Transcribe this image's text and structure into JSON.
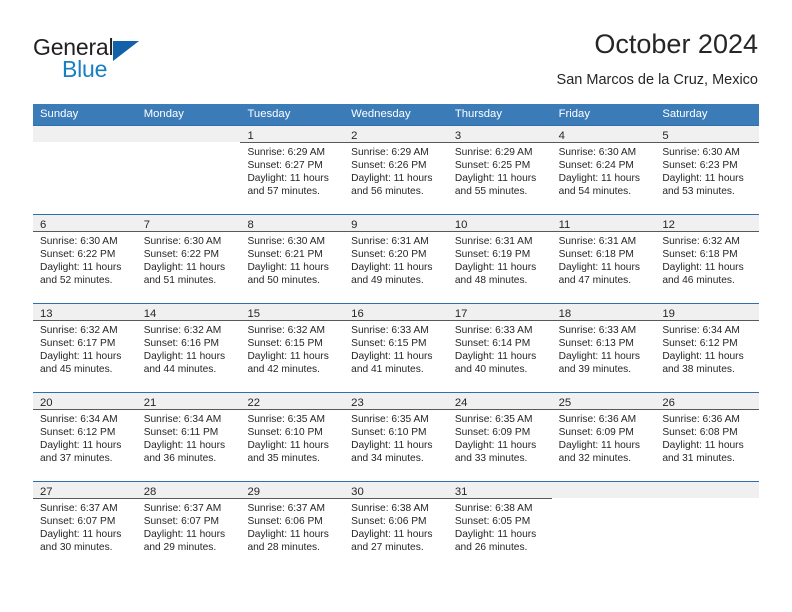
{
  "brand": {
    "name_part1": "General",
    "name_part2": "Blue"
  },
  "header": {
    "title": "October 2024",
    "subtitle": "San Marcos de la Cruz, Mexico"
  },
  "weekdays": [
    "Sunday",
    "Monday",
    "Tuesday",
    "Wednesday",
    "Thursday",
    "Friday",
    "Saturday"
  ],
  "colors": {
    "header_blue": "#3b7cb8",
    "row_rule_blue": "#2f6fae",
    "date_band": "#f0f0f0",
    "logo_blue": "#1a7fc1",
    "logo_triangle": "#1361a8",
    "text": "#262626"
  },
  "weeks": [
    [
      {
        "day": "",
        "sunrise": "",
        "sunset": "",
        "daylight_line1": "",
        "daylight_line2": ""
      },
      {
        "day": "",
        "sunrise": "",
        "sunset": "",
        "daylight_line1": "",
        "daylight_line2": ""
      },
      {
        "day": "1",
        "sunrise": "Sunrise: 6:29 AM",
        "sunset": "Sunset: 6:27 PM",
        "daylight_line1": "Daylight: 11 hours",
        "daylight_line2": "and 57 minutes."
      },
      {
        "day": "2",
        "sunrise": "Sunrise: 6:29 AM",
        "sunset": "Sunset: 6:26 PM",
        "daylight_line1": "Daylight: 11 hours",
        "daylight_line2": "and 56 minutes."
      },
      {
        "day": "3",
        "sunrise": "Sunrise: 6:29 AM",
        "sunset": "Sunset: 6:25 PM",
        "daylight_line1": "Daylight: 11 hours",
        "daylight_line2": "and 55 minutes."
      },
      {
        "day": "4",
        "sunrise": "Sunrise: 6:30 AM",
        "sunset": "Sunset: 6:24 PM",
        "daylight_line1": "Daylight: 11 hours",
        "daylight_line2": "and 54 minutes."
      },
      {
        "day": "5",
        "sunrise": "Sunrise: 6:30 AM",
        "sunset": "Sunset: 6:23 PM",
        "daylight_line1": "Daylight: 11 hours",
        "daylight_line2": "and 53 minutes."
      }
    ],
    [
      {
        "day": "6",
        "sunrise": "Sunrise: 6:30 AM",
        "sunset": "Sunset: 6:22 PM",
        "daylight_line1": "Daylight: 11 hours",
        "daylight_line2": "and 52 minutes."
      },
      {
        "day": "7",
        "sunrise": "Sunrise: 6:30 AM",
        "sunset": "Sunset: 6:22 PM",
        "daylight_line1": "Daylight: 11 hours",
        "daylight_line2": "and 51 minutes."
      },
      {
        "day": "8",
        "sunrise": "Sunrise: 6:30 AM",
        "sunset": "Sunset: 6:21 PM",
        "daylight_line1": "Daylight: 11 hours",
        "daylight_line2": "and 50 minutes."
      },
      {
        "day": "9",
        "sunrise": "Sunrise: 6:31 AM",
        "sunset": "Sunset: 6:20 PM",
        "daylight_line1": "Daylight: 11 hours",
        "daylight_line2": "and 49 minutes."
      },
      {
        "day": "10",
        "sunrise": "Sunrise: 6:31 AM",
        "sunset": "Sunset: 6:19 PM",
        "daylight_line1": "Daylight: 11 hours",
        "daylight_line2": "and 48 minutes."
      },
      {
        "day": "11",
        "sunrise": "Sunrise: 6:31 AM",
        "sunset": "Sunset: 6:18 PM",
        "daylight_line1": "Daylight: 11 hours",
        "daylight_line2": "and 47 minutes."
      },
      {
        "day": "12",
        "sunrise": "Sunrise: 6:32 AM",
        "sunset": "Sunset: 6:18 PM",
        "daylight_line1": "Daylight: 11 hours",
        "daylight_line2": "and 46 minutes."
      }
    ],
    [
      {
        "day": "13",
        "sunrise": "Sunrise: 6:32 AM",
        "sunset": "Sunset: 6:17 PM",
        "daylight_line1": "Daylight: 11 hours",
        "daylight_line2": "and 45 minutes."
      },
      {
        "day": "14",
        "sunrise": "Sunrise: 6:32 AM",
        "sunset": "Sunset: 6:16 PM",
        "daylight_line1": "Daylight: 11 hours",
        "daylight_line2": "and 44 minutes."
      },
      {
        "day": "15",
        "sunrise": "Sunrise: 6:32 AM",
        "sunset": "Sunset: 6:15 PM",
        "daylight_line1": "Daylight: 11 hours",
        "daylight_line2": "and 42 minutes."
      },
      {
        "day": "16",
        "sunrise": "Sunrise: 6:33 AM",
        "sunset": "Sunset: 6:15 PM",
        "daylight_line1": "Daylight: 11 hours",
        "daylight_line2": "and 41 minutes."
      },
      {
        "day": "17",
        "sunrise": "Sunrise: 6:33 AM",
        "sunset": "Sunset: 6:14 PM",
        "daylight_line1": "Daylight: 11 hours",
        "daylight_line2": "and 40 minutes."
      },
      {
        "day": "18",
        "sunrise": "Sunrise: 6:33 AM",
        "sunset": "Sunset: 6:13 PM",
        "daylight_line1": "Daylight: 11 hours",
        "daylight_line2": "and 39 minutes."
      },
      {
        "day": "19",
        "sunrise": "Sunrise: 6:34 AM",
        "sunset": "Sunset: 6:12 PM",
        "daylight_line1": "Daylight: 11 hours",
        "daylight_line2": "and 38 minutes."
      }
    ],
    [
      {
        "day": "20",
        "sunrise": "Sunrise: 6:34 AM",
        "sunset": "Sunset: 6:12 PM",
        "daylight_line1": "Daylight: 11 hours",
        "daylight_line2": "and 37 minutes."
      },
      {
        "day": "21",
        "sunrise": "Sunrise: 6:34 AM",
        "sunset": "Sunset: 6:11 PM",
        "daylight_line1": "Daylight: 11 hours",
        "daylight_line2": "and 36 minutes."
      },
      {
        "day": "22",
        "sunrise": "Sunrise: 6:35 AM",
        "sunset": "Sunset: 6:10 PM",
        "daylight_line1": "Daylight: 11 hours",
        "daylight_line2": "and 35 minutes."
      },
      {
        "day": "23",
        "sunrise": "Sunrise: 6:35 AM",
        "sunset": "Sunset: 6:10 PM",
        "daylight_line1": "Daylight: 11 hours",
        "daylight_line2": "and 34 minutes."
      },
      {
        "day": "24",
        "sunrise": "Sunrise: 6:35 AM",
        "sunset": "Sunset: 6:09 PM",
        "daylight_line1": "Daylight: 11 hours",
        "daylight_line2": "and 33 minutes."
      },
      {
        "day": "25",
        "sunrise": "Sunrise: 6:36 AM",
        "sunset": "Sunset: 6:09 PM",
        "daylight_line1": "Daylight: 11 hours",
        "daylight_line2": "and 32 minutes."
      },
      {
        "day": "26",
        "sunrise": "Sunrise: 6:36 AM",
        "sunset": "Sunset: 6:08 PM",
        "daylight_line1": "Daylight: 11 hours",
        "daylight_line2": "and 31 minutes."
      }
    ],
    [
      {
        "day": "27",
        "sunrise": "Sunrise: 6:37 AM",
        "sunset": "Sunset: 6:07 PM",
        "daylight_line1": "Daylight: 11 hours",
        "daylight_line2": "and 30 minutes."
      },
      {
        "day": "28",
        "sunrise": "Sunrise: 6:37 AM",
        "sunset": "Sunset: 6:07 PM",
        "daylight_line1": "Daylight: 11 hours",
        "daylight_line2": "and 29 minutes."
      },
      {
        "day": "29",
        "sunrise": "Sunrise: 6:37 AM",
        "sunset": "Sunset: 6:06 PM",
        "daylight_line1": "Daylight: 11 hours",
        "daylight_line2": "and 28 minutes."
      },
      {
        "day": "30",
        "sunrise": "Sunrise: 6:38 AM",
        "sunset": "Sunset: 6:06 PM",
        "daylight_line1": "Daylight: 11 hours",
        "daylight_line2": "and 27 minutes."
      },
      {
        "day": "31",
        "sunrise": "Sunrise: 6:38 AM",
        "sunset": "Sunset: 6:05 PM",
        "daylight_line1": "Daylight: 11 hours",
        "daylight_line2": "and 26 minutes."
      },
      {
        "day": "",
        "sunrise": "",
        "sunset": "",
        "daylight_line1": "",
        "daylight_line2": ""
      },
      {
        "day": "",
        "sunrise": "",
        "sunset": "",
        "daylight_line1": "",
        "daylight_line2": ""
      }
    ]
  ]
}
